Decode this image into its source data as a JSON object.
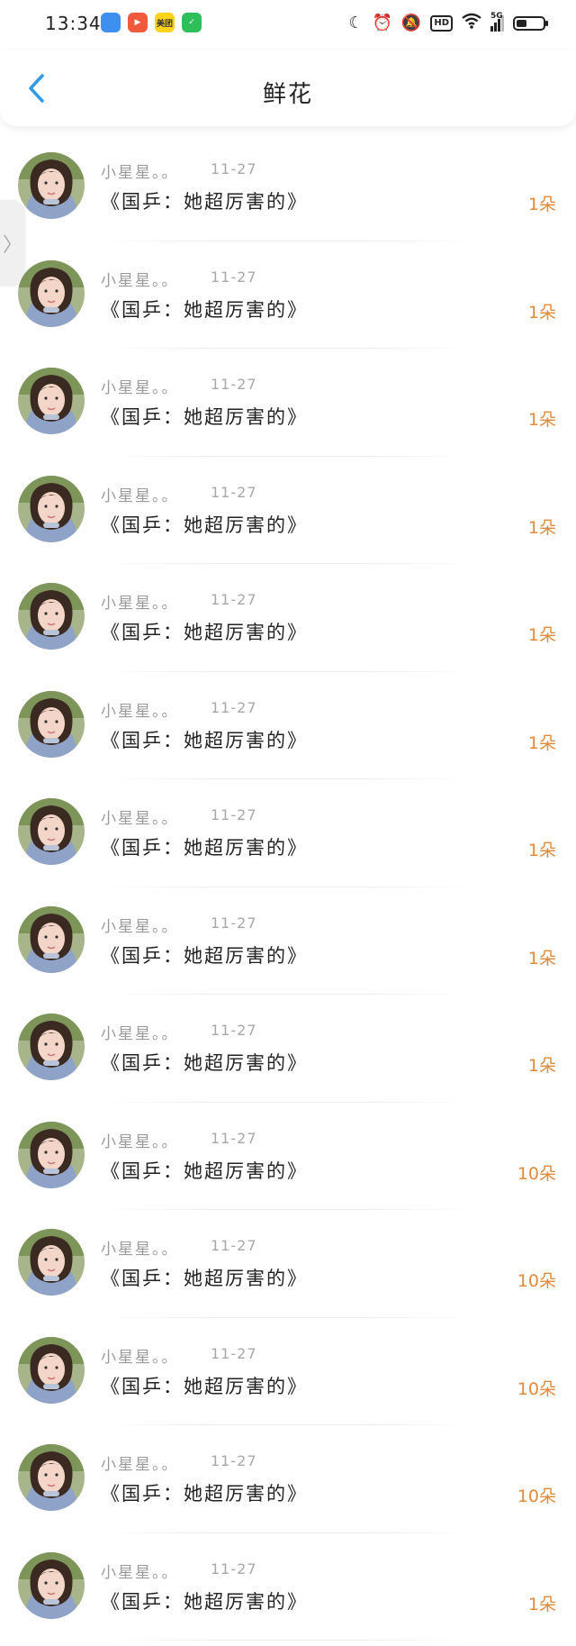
{
  "status_bar": {
    "time": "13:34",
    "apps": [
      {
        "name": "app-blue-icon",
        "color": "#3d8ff0",
        "label": ""
      },
      {
        "name": "app-play-icon",
        "color": "#ef5a3c",
        "label": "▶"
      },
      {
        "name": "meituan-icon",
        "color": "#ffd21c",
        "label": "美团"
      },
      {
        "name": "app-green-icon",
        "color": "#2fbf5a",
        "label": "✓"
      }
    ],
    "hd_label": "HD",
    "network_label": "5G",
    "battery_level": 0.4
  },
  "header": {
    "title": "鲜花"
  },
  "colors": {
    "accent_back": "#2f9ae8",
    "count": "#e08a3c"
  },
  "items": [
    {
      "user": "小星星。。",
      "date": "11-27",
      "title": "《国乒：她超厉害的》",
      "count": "1朵"
    },
    {
      "user": "小星星。。",
      "date": "11-27",
      "title": "《国乒：她超厉害的》",
      "count": "1朵"
    },
    {
      "user": "小星星。。",
      "date": "11-27",
      "title": "《国乒：她超厉害的》",
      "count": "1朵"
    },
    {
      "user": "小星星。。",
      "date": "11-27",
      "title": "《国乒：她超厉害的》",
      "count": "1朵"
    },
    {
      "user": "小星星。。",
      "date": "11-27",
      "title": "《国乒：她超厉害的》",
      "count": "1朵"
    },
    {
      "user": "小星星。。",
      "date": "11-27",
      "title": "《国乒：她超厉害的》",
      "count": "1朵"
    },
    {
      "user": "小星星。。",
      "date": "11-27",
      "title": "《国乒：她超厉害的》",
      "count": "1朵"
    },
    {
      "user": "小星星。。",
      "date": "11-27",
      "title": "《国乒：她超厉害的》",
      "count": "1朵"
    },
    {
      "user": "小星星。。",
      "date": "11-27",
      "title": "《国乒：她超厉害的》",
      "count": "1朵"
    },
    {
      "user": "小星星。。",
      "date": "11-27",
      "title": "《国乒：她超厉害的》",
      "count": "10朵"
    },
    {
      "user": "小星星。。",
      "date": "11-27",
      "title": "《国乒：她超厉害的》",
      "count": "10朵"
    },
    {
      "user": "小星星。。",
      "date": "11-27",
      "title": "《国乒：她超厉害的》",
      "count": "10朵"
    },
    {
      "user": "小星星。。",
      "date": "11-27",
      "title": "《国乒：她超厉害的》",
      "count": "10朵"
    },
    {
      "user": "小星星。。",
      "date": "11-27",
      "title": "《国乒：她超厉害的》",
      "count": "1朵"
    }
  ]
}
